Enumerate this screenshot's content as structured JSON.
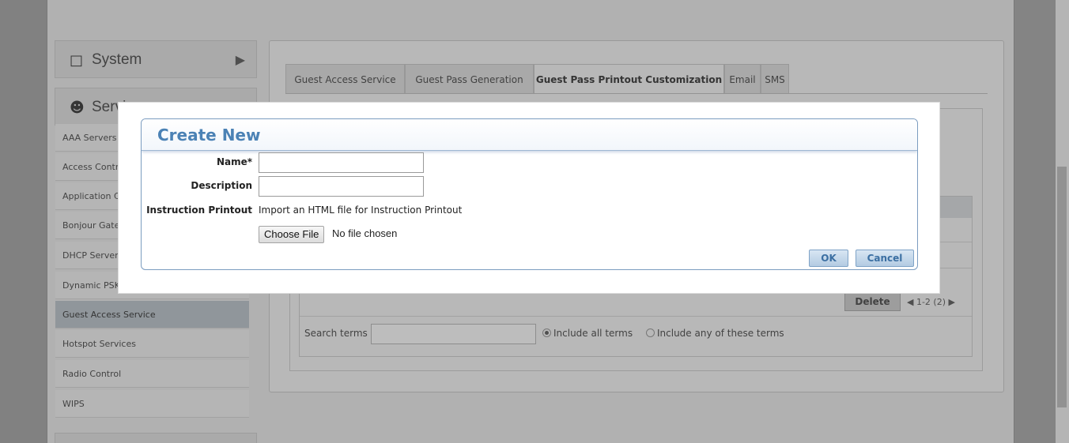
{
  "sidebar": {
    "system_label": "System",
    "services_label": "Services",
    "items": [
      {
        "label": "AAA Servers"
      },
      {
        "label": "Access Control"
      },
      {
        "label": "Application Control"
      },
      {
        "label": "Bonjour Gateway"
      },
      {
        "label": "DHCP Server"
      },
      {
        "label": "Dynamic PSK"
      },
      {
        "label": "Guest Access Service",
        "active": true
      },
      {
        "label": "Hotspot Services"
      },
      {
        "label": "Radio Control"
      },
      {
        "label": "WIPS"
      }
    ]
  },
  "tabs": [
    {
      "label": "Guest Access Service"
    },
    {
      "label": "Guest Pass Generation"
    },
    {
      "label": "Guest Pass Printout Customization",
      "active": true
    },
    {
      "label": "Email"
    },
    {
      "label": "SMS"
    }
  ],
  "grid": {
    "delete_label": "Delete",
    "pager": "1-2 (2)",
    "search_label": "Search terms",
    "search_value": "",
    "radio_all": "Include all terms",
    "radio_any": "Include any of these terms"
  },
  "dialog": {
    "title": "Create New",
    "name_label": "Name*",
    "name_value": "",
    "description_label": "Description",
    "description_value": "",
    "instruction_label": "Instruction Printout",
    "instruction_text": "Import an HTML file for Instruction Printout",
    "choose_file_label": "Choose File",
    "no_file_text": "No file chosen",
    "ok_label": "OK",
    "cancel_label": "Cancel"
  },
  "colors": {
    "dialog_title": "#4b82b5",
    "dialog_border": "#7b9cc0",
    "active_sidebar": "#b9c0c7"
  }
}
